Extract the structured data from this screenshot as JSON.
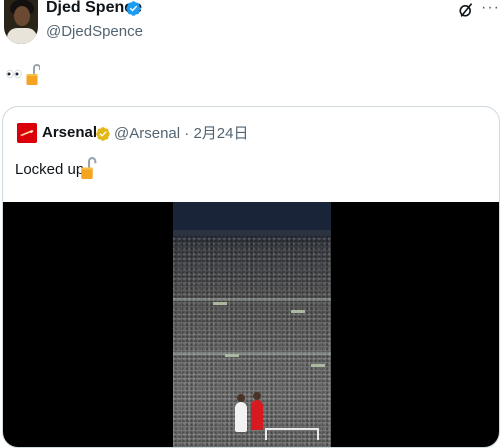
{
  "post": {
    "author_name": "Djed Spence",
    "author_handle": "@DjedSpence",
    "verified": true,
    "text_icons": [
      "eyes-icon",
      "lock-icon"
    ],
    "menu_icons": [
      "grok-icon",
      "more-icon"
    ],
    "more_glyph": "···"
  },
  "quoted": {
    "author_name": "Arsenal",
    "author_handle": "@Arsenal",
    "separator": "·",
    "date": "2月24日",
    "text": "Locked up",
    "text_icon": "lock-icon",
    "media": "video"
  },
  "colors": {
    "verified_blue": "#1d9bf0",
    "verified_gold": "#e2b719",
    "arsenal_red": "#db0007",
    "secondary_text": "#536471"
  }
}
